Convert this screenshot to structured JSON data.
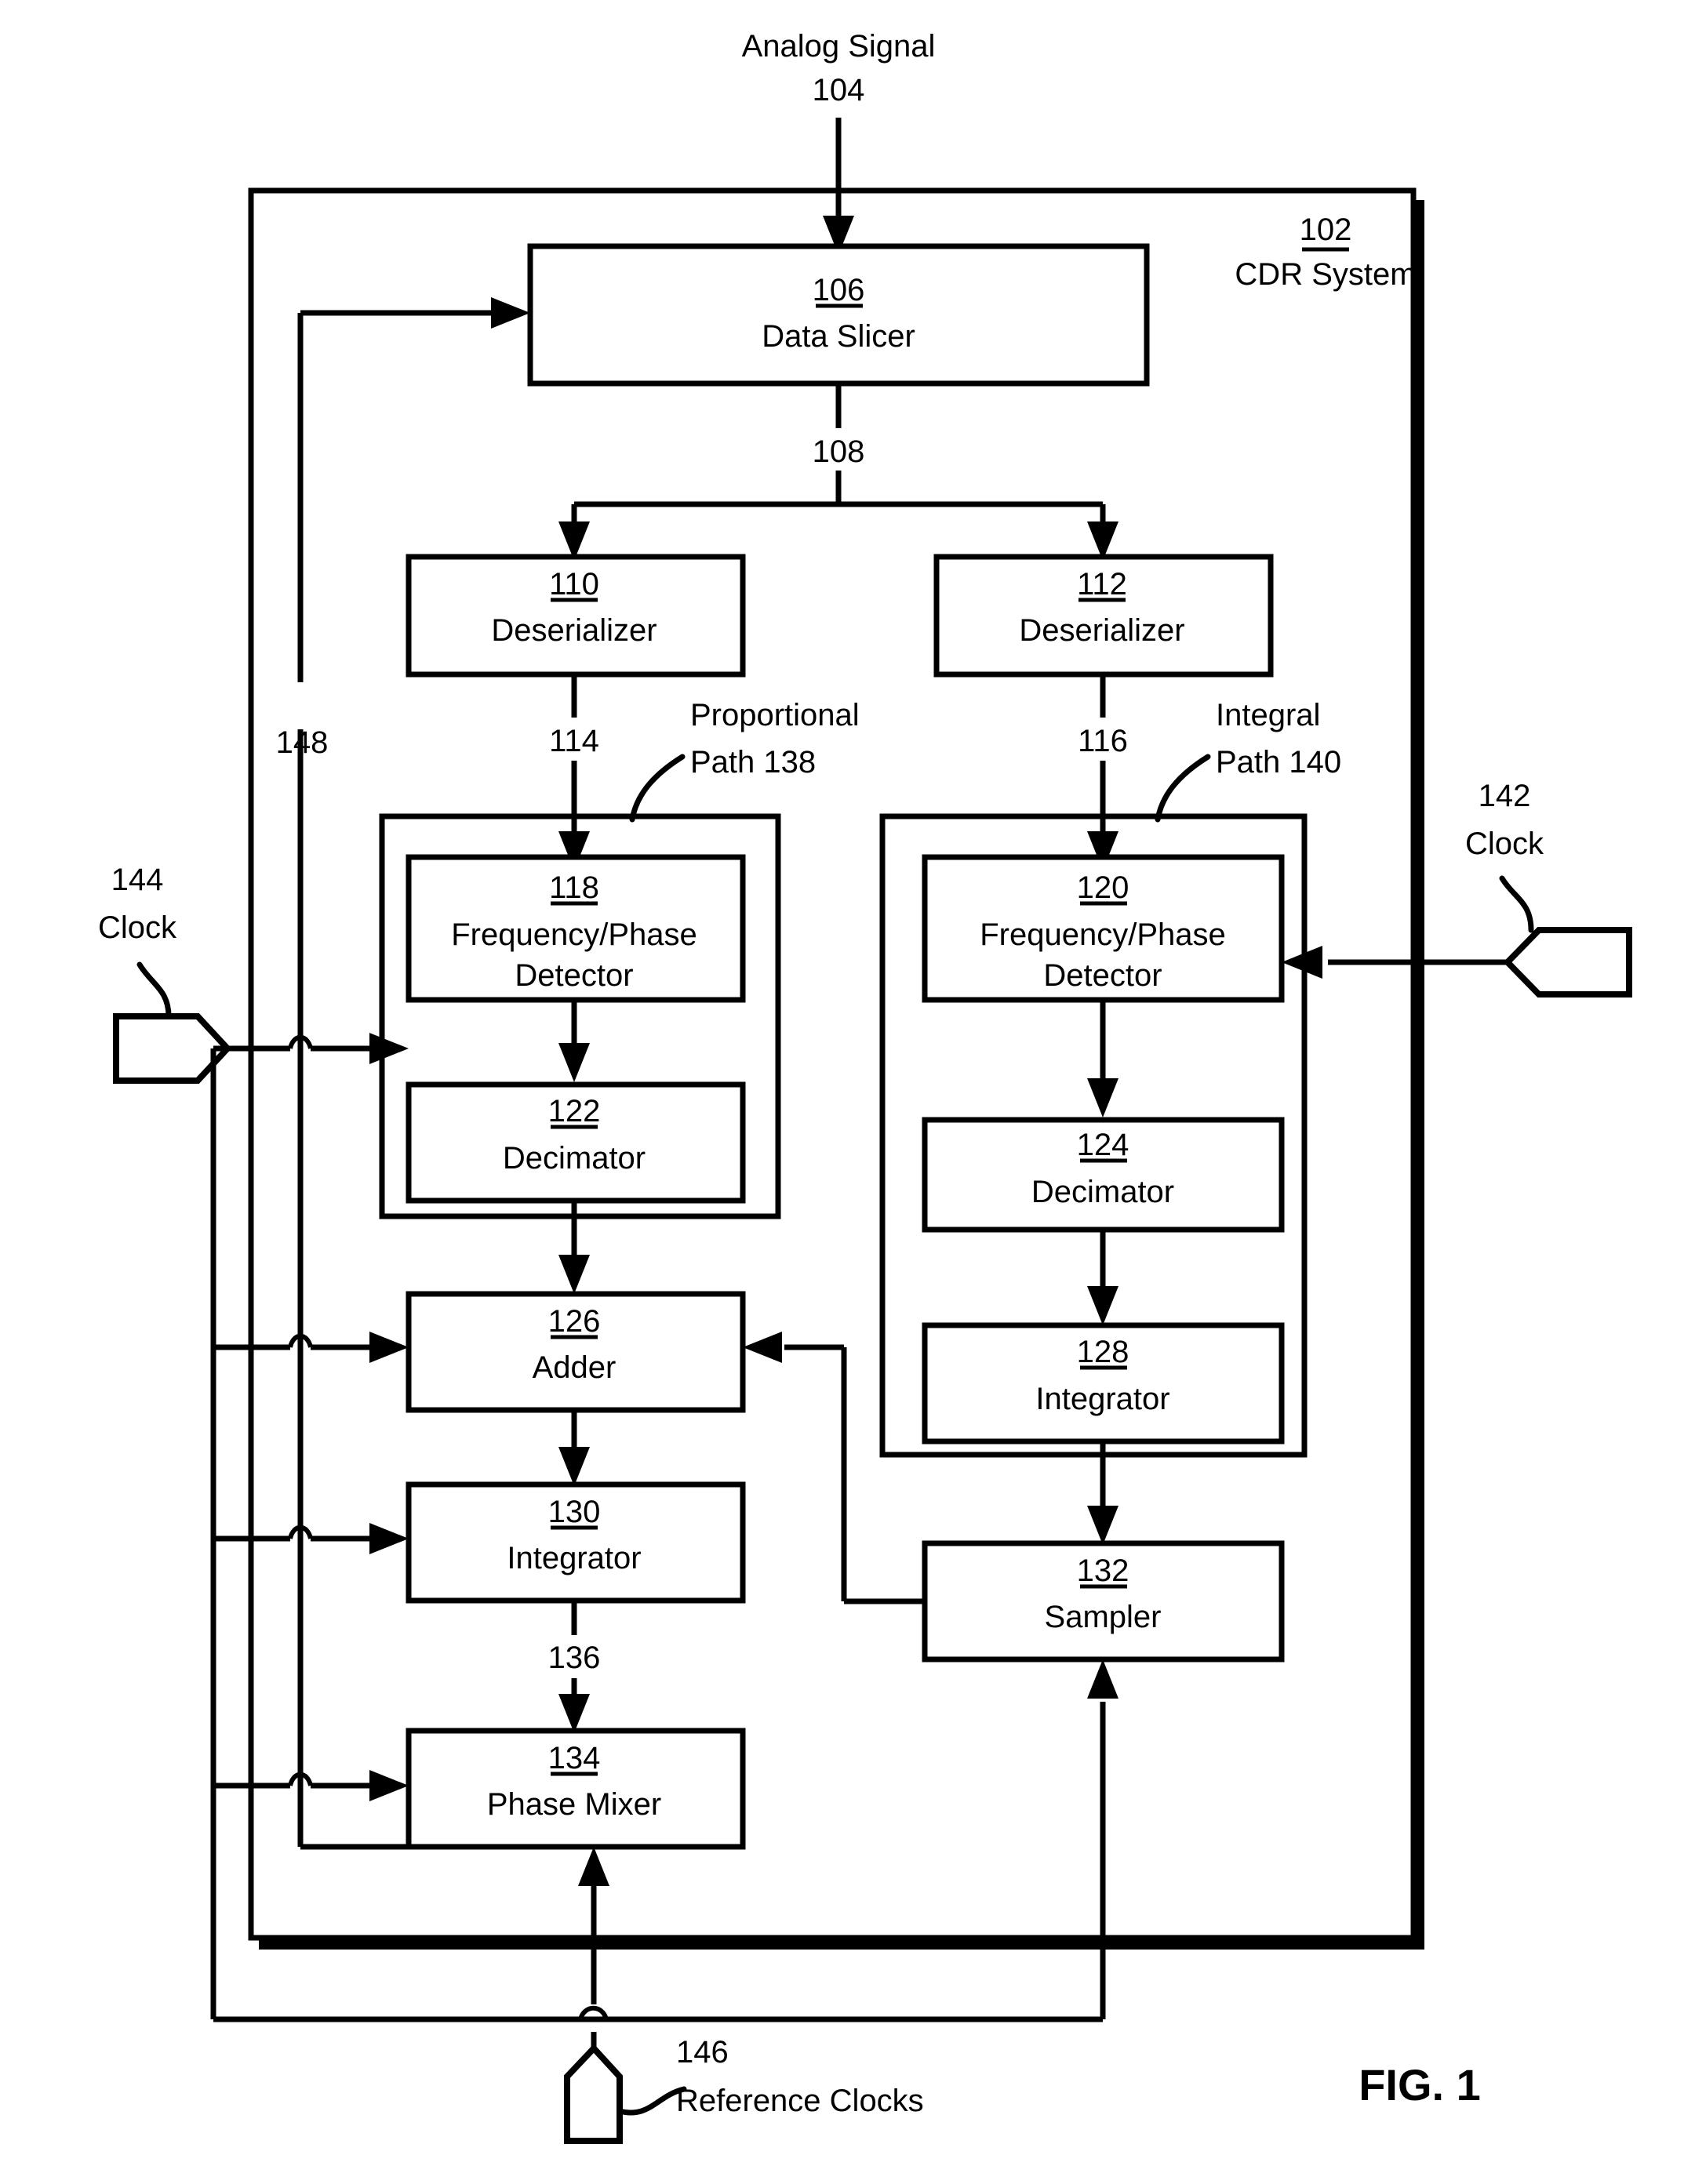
{
  "figure": {
    "label": "FIG. 1",
    "title_signal": "Analog Signal",
    "title_signal_ref": "104"
  },
  "system": {
    "ref": "102",
    "name": "CDR System"
  },
  "blocks": [
    {
      "id": "data_slicer",
      "ref": "106",
      "name": "Data Slicer"
    },
    {
      "id": "deser_left",
      "ref": "110",
      "name": "Deserializer"
    },
    {
      "id": "deser_right",
      "ref": "112",
      "name": "Deserializer"
    },
    {
      "id": "fpd_left",
      "ref": "118",
      "name": "Frequency/Phase",
      "name2": "Detector"
    },
    {
      "id": "fpd_right",
      "ref": "120",
      "name": "Frequency/Phase",
      "name2": "Detector"
    },
    {
      "id": "decim_left",
      "ref": "122",
      "name": "Decimator"
    },
    {
      "id": "decim_right",
      "ref": "124",
      "name": "Decimator"
    },
    {
      "id": "adder",
      "ref": "126",
      "name": "Adder"
    },
    {
      "id": "integ_right",
      "ref": "128",
      "name": "Integrator"
    },
    {
      "id": "integ_left",
      "ref": "130",
      "name": "Integrator"
    },
    {
      "id": "sampler",
      "ref": "132",
      "name": "Sampler"
    },
    {
      "id": "phase_mixer",
      "ref": "134",
      "name": "Phase Mixer"
    }
  ],
  "paths": [
    {
      "id": "proportional",
      "line1": "Proportional",
      "line2": "Path 138"
    },
    {
      "id": "integral",
      "line1": "Integral",
      "line2": "Path 140"
    }
  ],
  "signals": [
    {
      "id": "sig108",
      "ref": "108"
    },
    {
      "id": "sig114",
      "ref": "114"
    },
    {
      "id": "sig116",
      "ref": "116"
    },
    {
      "id": "sig136",
      "ref": "136"
    },
    {
      "id": "sig148",
      "ref": "148"
    }
  ],
  "clocks": [
    {
      "id": "clock144",
      "ref": "144",
      "name": "Clock"
    },
    {
      "id": "clock142",
      "ref": "142",
      "name": "Clock"
    },
    {
      "id": "clock146",
      "ref": "146",
      "name": "Reference Clocks"
    }
  ]
}
